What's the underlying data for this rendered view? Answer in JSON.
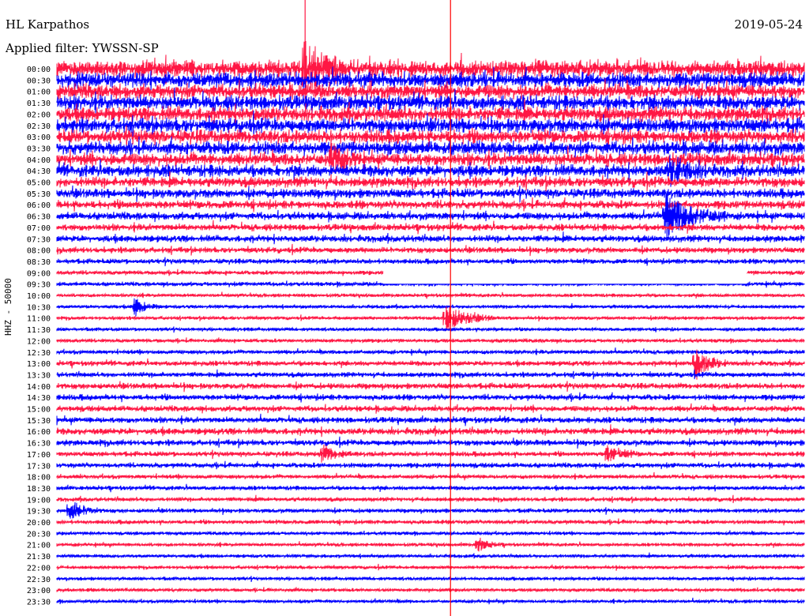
{
  "header": {
    "station": "HL Karpathos",
    "date": "2019-05-24",
    "filter": "Applied filter: YWSSN-SP"
  },
  "chart_data": {
    "type": "line",
    "title": "HL Karpathos",
    "ylabel": "HHZ - 50000",
    "xlabel": "",
    "row_labels": [
      "00:00",
      "00:30",
      "01:00",
      "01:30",
      "02:00",
      "02:30",
      "03:00",
      "03:30",
      "04:00",
      "04:30",
      "05:00",
      "05:30",
      "06:00",
      "06:30",
      "07:00",
      "07:30",
      "08:00",
      "08:30",
      "09:00",
      "09:30",
      "10:00",
      "10:30",
      "11:00",
      "11:30",
      "12:00",
      "12:30",
      "13:00",
      "13:30",
      "14:00",
      "14:30",
      "15:00",
      "15:30",
      "16:00",
      "16:30",
      "17:00",
      "17:30",
      "18:00",
      "18:30",
      "19:00",
      "19:30",
      "20:00",
      "20:30",
      "21:00",
      "21:30",
      "22:00",
      "22:30",
      "23:00",
      "23:30"
    ],
    "trace_colors": [
      "#ff1744",
      "#0000ff"
    ],
    "marker_color": "#ff0000",
    "marker_minute": 15.8,
    "gap": {
      "row": "09:00",
      "start_minute": 13.1,
      "end_minute": 27.7
    },
    "row_minutes": 30,
    "noise_levels": [
      1.0,
      0.9,
      0.85,
      0.85,
      0.85,
      0.85,
      0.8,
      0.8,
      0.75,
      0.7,
      0.6,
      0.55,
      0.5,
      0.45,
      0.4,
      0.4,
      0.35,
      0.3,
      0.25,
      0.25,
      0.2,
      0.2,
      0.2,
      0.2,
      0.22,
      0.25,
      0.3,
      0.3,
      0.35,
      0.35,
      0.35,
      0.35,
      0.4,
      0.35,
      0.3,
      0.3,
      0.25,
      0.25,
      0.25,
      0.25,
      0.25,
      0.2,
      0.2,
      0.2,
      0.2,
      0.2,
      0.2,
      0.2
    ],
    "events": [
      {
        "row": "00:00",
        "minute": 9.9,
        "amplitude": 3.0,
        "length_minutes": 0.6
      },
      {
        "row": "04:00",
        "minute": 11.0,
        "amplitude": 1.6,
        "length_minutes": 0.5
      },
      {
        "row": "04:30",
        "minute": 24.6,
        "amplitude": 1.4,
        "length_minutes": 0.7
      },
      {
        "row": "06:30",
        "minute": 24.4,
        "amplitude": 2.4,
        "length_minutes": 1.0
      },
      {
        "row": "09:00",
        "minute": 15.3,
        "amplitude": 1.4,
        "length_minutes": 0.6
      },
      {
        "row": "09:00",
        "minute": 25.2,
        "amplitude": 1.2,
        "length_minutes": 0.6
      },
      {
        "row": "10:30",
        "minute": 3.1,
        "amplitude": 1.0,
        "length_minutes": 0.4
      },
      {
        "row": "11:00",
        "minute": 15.6,
        "amplitude": 1.4,
        "length_minutes": 0.8
      },
      {
        "row": "13:00",
        "minute": 25.6,
        "amplitude": 1.8,
        "length_minutes": 0.5
      },
      {
        "row": "17:00",
        "minute": 10.6,
        "amplitude": 1.0,
        "length_minutes": 0.5
      },
      {
        "row": "17:00",
        "minute": 22.1,
        "amplitude": 1.0,
        "length_minutes": 0.5
      },
      {
        "row": "19:30",
        "minute": 0.5,
        "amplitude": 1.2,
        "length_minutes": 0.5
      },
      {
        "row": "21:00",
        "minute": 16.9,
        "amplitude": 0.7,
        "length_minutes": 0.4
      }
    ]
  }
}
